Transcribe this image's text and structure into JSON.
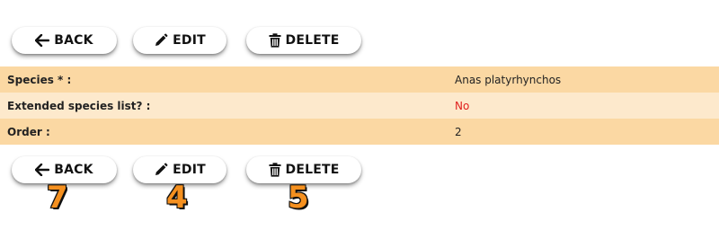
{
  "toolbar": {
    "back_label": "BACK",
    "edit_label": "EDIT",
    "delete_label": "DELETE"
  },
  "icons": {
    "back": "arrow-left-icon",
    "edit": "pencil-icon",
    "delete": "trash-icon"
  },
  "details": {
    "rows": [
      {
        "label": "Species * :",
        "value": "Anas platyrhynchos"
      },
      {
        "label": "Extended species list? :",
        "value": "No"
      },
      {
        "label": "Order :",
        "value": "2"
      }
    ]
  },
  "step_numbers": {
    "back": "7",
    "edit": "4",
    "delete": "5"
  },
  "colors": {
    "row_dark": "#fbd8a3",
    "row_light": "#fde9cc",
    "no_value": "#e0211f",
    "step_number": "#f5901f"
  }
}
